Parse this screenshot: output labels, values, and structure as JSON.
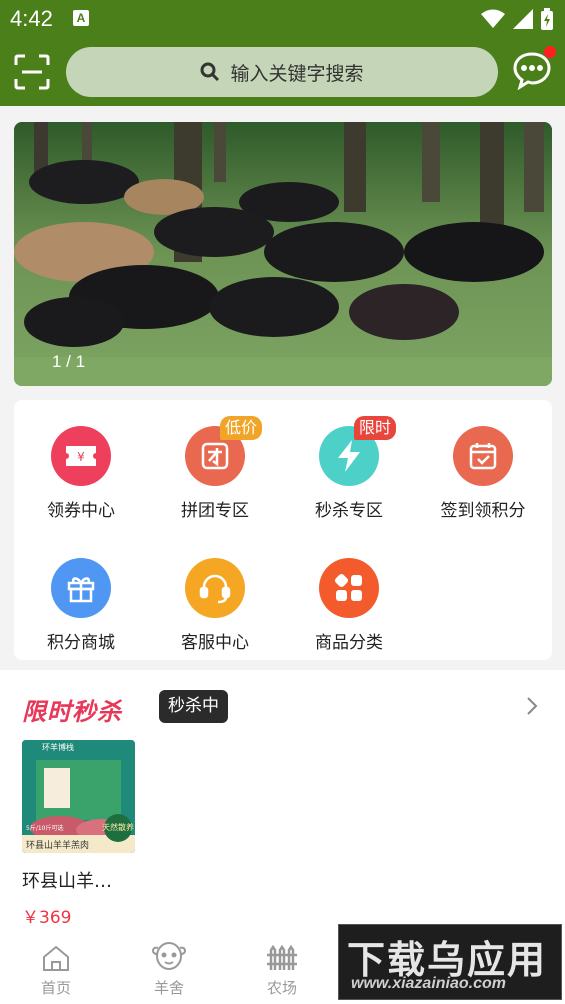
{
  "status_bar": {
    "time": "4:42",
    "notification_letter": "A"
  },
  "header": {
    "search_placeholder": "输入关键字搜索",
    "scan_icon": "scan-icon",
    "message_icon": "chat-bubble-icon",
    "has_unread": true
  },
  "banner": {
    "indicator": "1 / 1"
  },
  "quick_menu": {
    "items": [
      {
        "label": "领券中心",
        "icon": "coupon-icon",
        "color": "#ee3f5d",
        "badge": ""
      },
      {
        "label": "拼团专区",
        "icon": "group-buy-icon",
        "color": "#e8694f",
        "badge": "低价",
        "badge_color": "#f0a428"
      },
      {
        "label": "秒杀专区",
        "icon": "lightning-icon",
        "color": "#4dd0c8",
        "badge": "限时",
        "badge_color": "#e8453c"
      },
      {
        "label": "签到领积分",
        "icon": "calendar-check-icon",
        "color": "#e8694f",
        "badge": ""
      },
      {
        "label": "积分商城",
        "icon": "gift-icon",
        "color": "#4f97f2",
        "badge": ""
      },
      {
        "label": "客服中心",
        "icon": "headset-icon",
        "color": "#f5a623",
        "badge": ""
      },
      {
        "label": "商品分类",
        "icon": "category-grid-icon",
        "color": "#f35b2c",
        "badge": ""
      }
    ]
  },
  "flash_sale": {
    "title": "限时秒杀",
    "status": "秒杀中",
    "products": [
      {
        "name": "环县山羊…",
        "price": "￥369",
        "image_caption": "环县山羊羊羔肉",
        "image_brand": "环羊博栈",
        "image_tag": "天然散养",
        "image_weight": "5斤/10斤可选"
      }
    ]
  },
  "tab_bar": {
    "items": [
      {
        "label": "首页",
        "icon": "home-icon"
      },
      {
        "label": "羊舍",
        "icon": "sheep-face-icon"
      },
      {
        "label": "农场",
        "icon": "farm-fence-icon"
      }
    ]
  },
  "watermark": {
    "main": "下载乌应用",
    "sub": "www.xiazainiao.com"
  }
}
